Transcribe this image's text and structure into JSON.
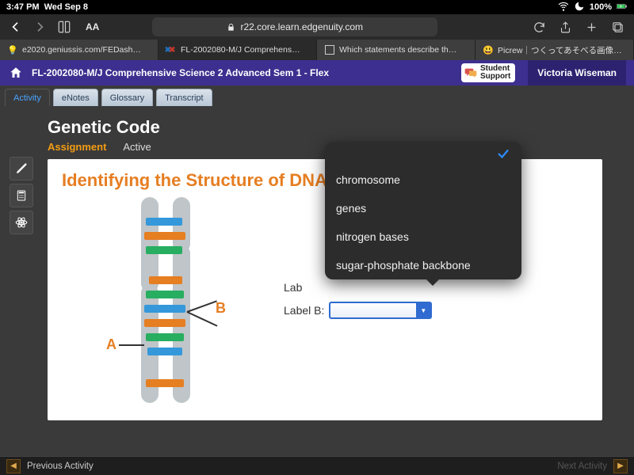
{
  "status": {
    "time": "3:47 PM",
    "date": "Wed Sep 8",
    "battery": "100%"
  },
  "browser": {
    "url_host": "r22.core.learn.edgenuity.com",
    "aa": "AA"
  },
  "tabs": [
    {
      "label": "e2020.geniussis.com/FEDash…"
    },
    {
      "label": "FL-2002080-M/J Comprehens…"
    },
    {
      "label": "Which statements describe th…"
    },
    {
      "label": "Picrew｜つくってあそべる画像…"
    }
  ],
  "course": {
    "title": "FL-2002080-M/J Comprehensive Science 2 Advanced Sem 1 - Flex",
    "support_top": "Student",
    "support_bottom": "Support",
    "user": "Victoria Wiseman"
  },
  "inner_tabs": {
    "activity": "Activity",
    "enotes": "eNotes",
    "glossary": "Glossary",
    "transcript": "Transcript"
  },
  "lesson": {
    "title": "Genetic Code",
    "assignment": "Assignment",
    "active": "Active",
    "heading": "Identifying the Structure of DNA",
    "right_text_suffix": "f DNA.",
    "labelA_prefix": "Lab",
    "labelB": "Label B:",
    "marker_a": "A",
    "marker_b": "B"
  },
  "dropdown": {
    "options": [
      "chromosome",
      "genes",
      "nitrogen bases",
      "sugar-phosphate backbone"
    ]
  },
  "footer": {
    "prev": "Previous Activity",
    "next": "Next Activity"
  }
}
